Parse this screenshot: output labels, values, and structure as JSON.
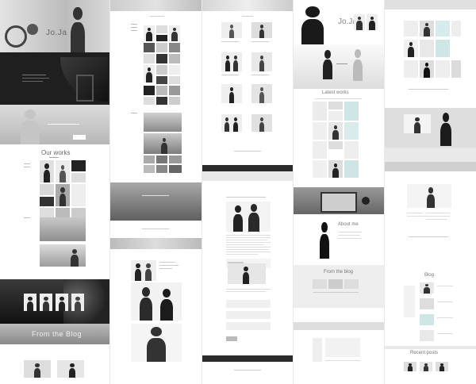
{
  "theme": {
    "accent": "#222222",
    "light": "#ffffff",
    "mid": "#cfcfcf"
  },
  "col1": {
    "hero_title": "Jo.Ja",
    "works_heading": "Our works",
    "blog_heading": "From the Blog"
  },
  "col3": {
    "hero_title": "Jo.Ja",
    "works_heading": "Latest works",
    "about_heading": "About me",
    "blog_heading": "From the blog"
  },
  "col4": {
    "blog_heading": "Blog",
    "recent_heading": "Recent posts"
  }
}
